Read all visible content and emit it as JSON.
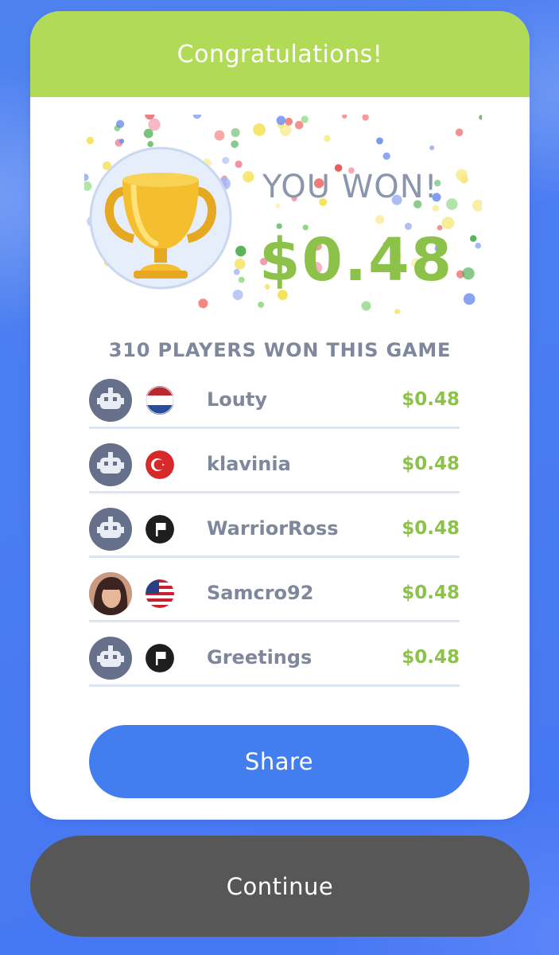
{
  "header": {
    "title": "Congratulations!"
  },
  "hero": {
    "you_won": "YOU WON!",
    "prize": "$0.48"
  },
  "summary": {
    "players_won": "310 PLAYERS WON THIS GAME"
  },
  "winners": [
    {
      "name": "Louty",
      "amount": "$0.48",
      "avatar": "robot-avatar-icon",
      "flag": "netherlands-flag-icon"
    },
    {
      "name": "klavinia",
      "amount": "$0.48",
      "avatar": "robot-avatar-icon",
      "flag": "turkey-flag-icon"
    },
    {
      "name": "WarriorRoss",
      "amount": "$0.48",
      "avatar": "robot-avatar-icon",
      "flag": "black-flag-icon"
    },
    {
      "name": "Samcro92",
      "amount": "$0.48",
      "avatar": "user-photo-avatar",
      "flag": "usa-flag-icon"
    },
    {
      "name": "Greetings",
      "amount": "$0.48",
      "avatar": "robot-avatar-icon",
      "flag": "black-flag-icon"
    }
  ],
  "buttons": {
    "share": "Share",
    "continue": "Continue"
  },
  "colors": {
    "header_green": "#b1da57",
    "prize_green": "#8dc24a",
    "share_blue": "#437ef1",
    "continue_gray": "#575757",
    "text_gray": "#7e879c"
  }
}
